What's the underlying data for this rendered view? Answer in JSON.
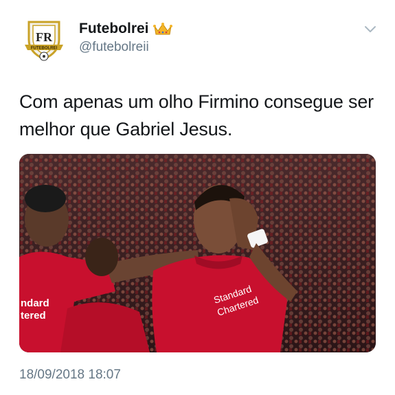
{
  "tweet": {
    "display_name": "Futebolrei",
    "handle": "@futebolreii",
    "text": "Com apenas um olho Firmino consegue ser melhor que Gabriel Jesus.",
    "timestamp": "18/09/2018 18:07",
    "avatar_text": "FUTEBOLREI",
    "media_caption": {
      "shirt_left_1": "ndard",
      "shirt_left_2": "tered",
      "shirt_center_1": "Standard",
      "shirt_center_2": "Chartered"
    }
  },
  "icons": {
    "crown": "crown-icon",
    "caret": "chevron-down-icon"
  },
  "colors": {
    "text": "#14171a",
    "secondary": "#657786",
    "kit_red": "#c8102e"
  }
}
